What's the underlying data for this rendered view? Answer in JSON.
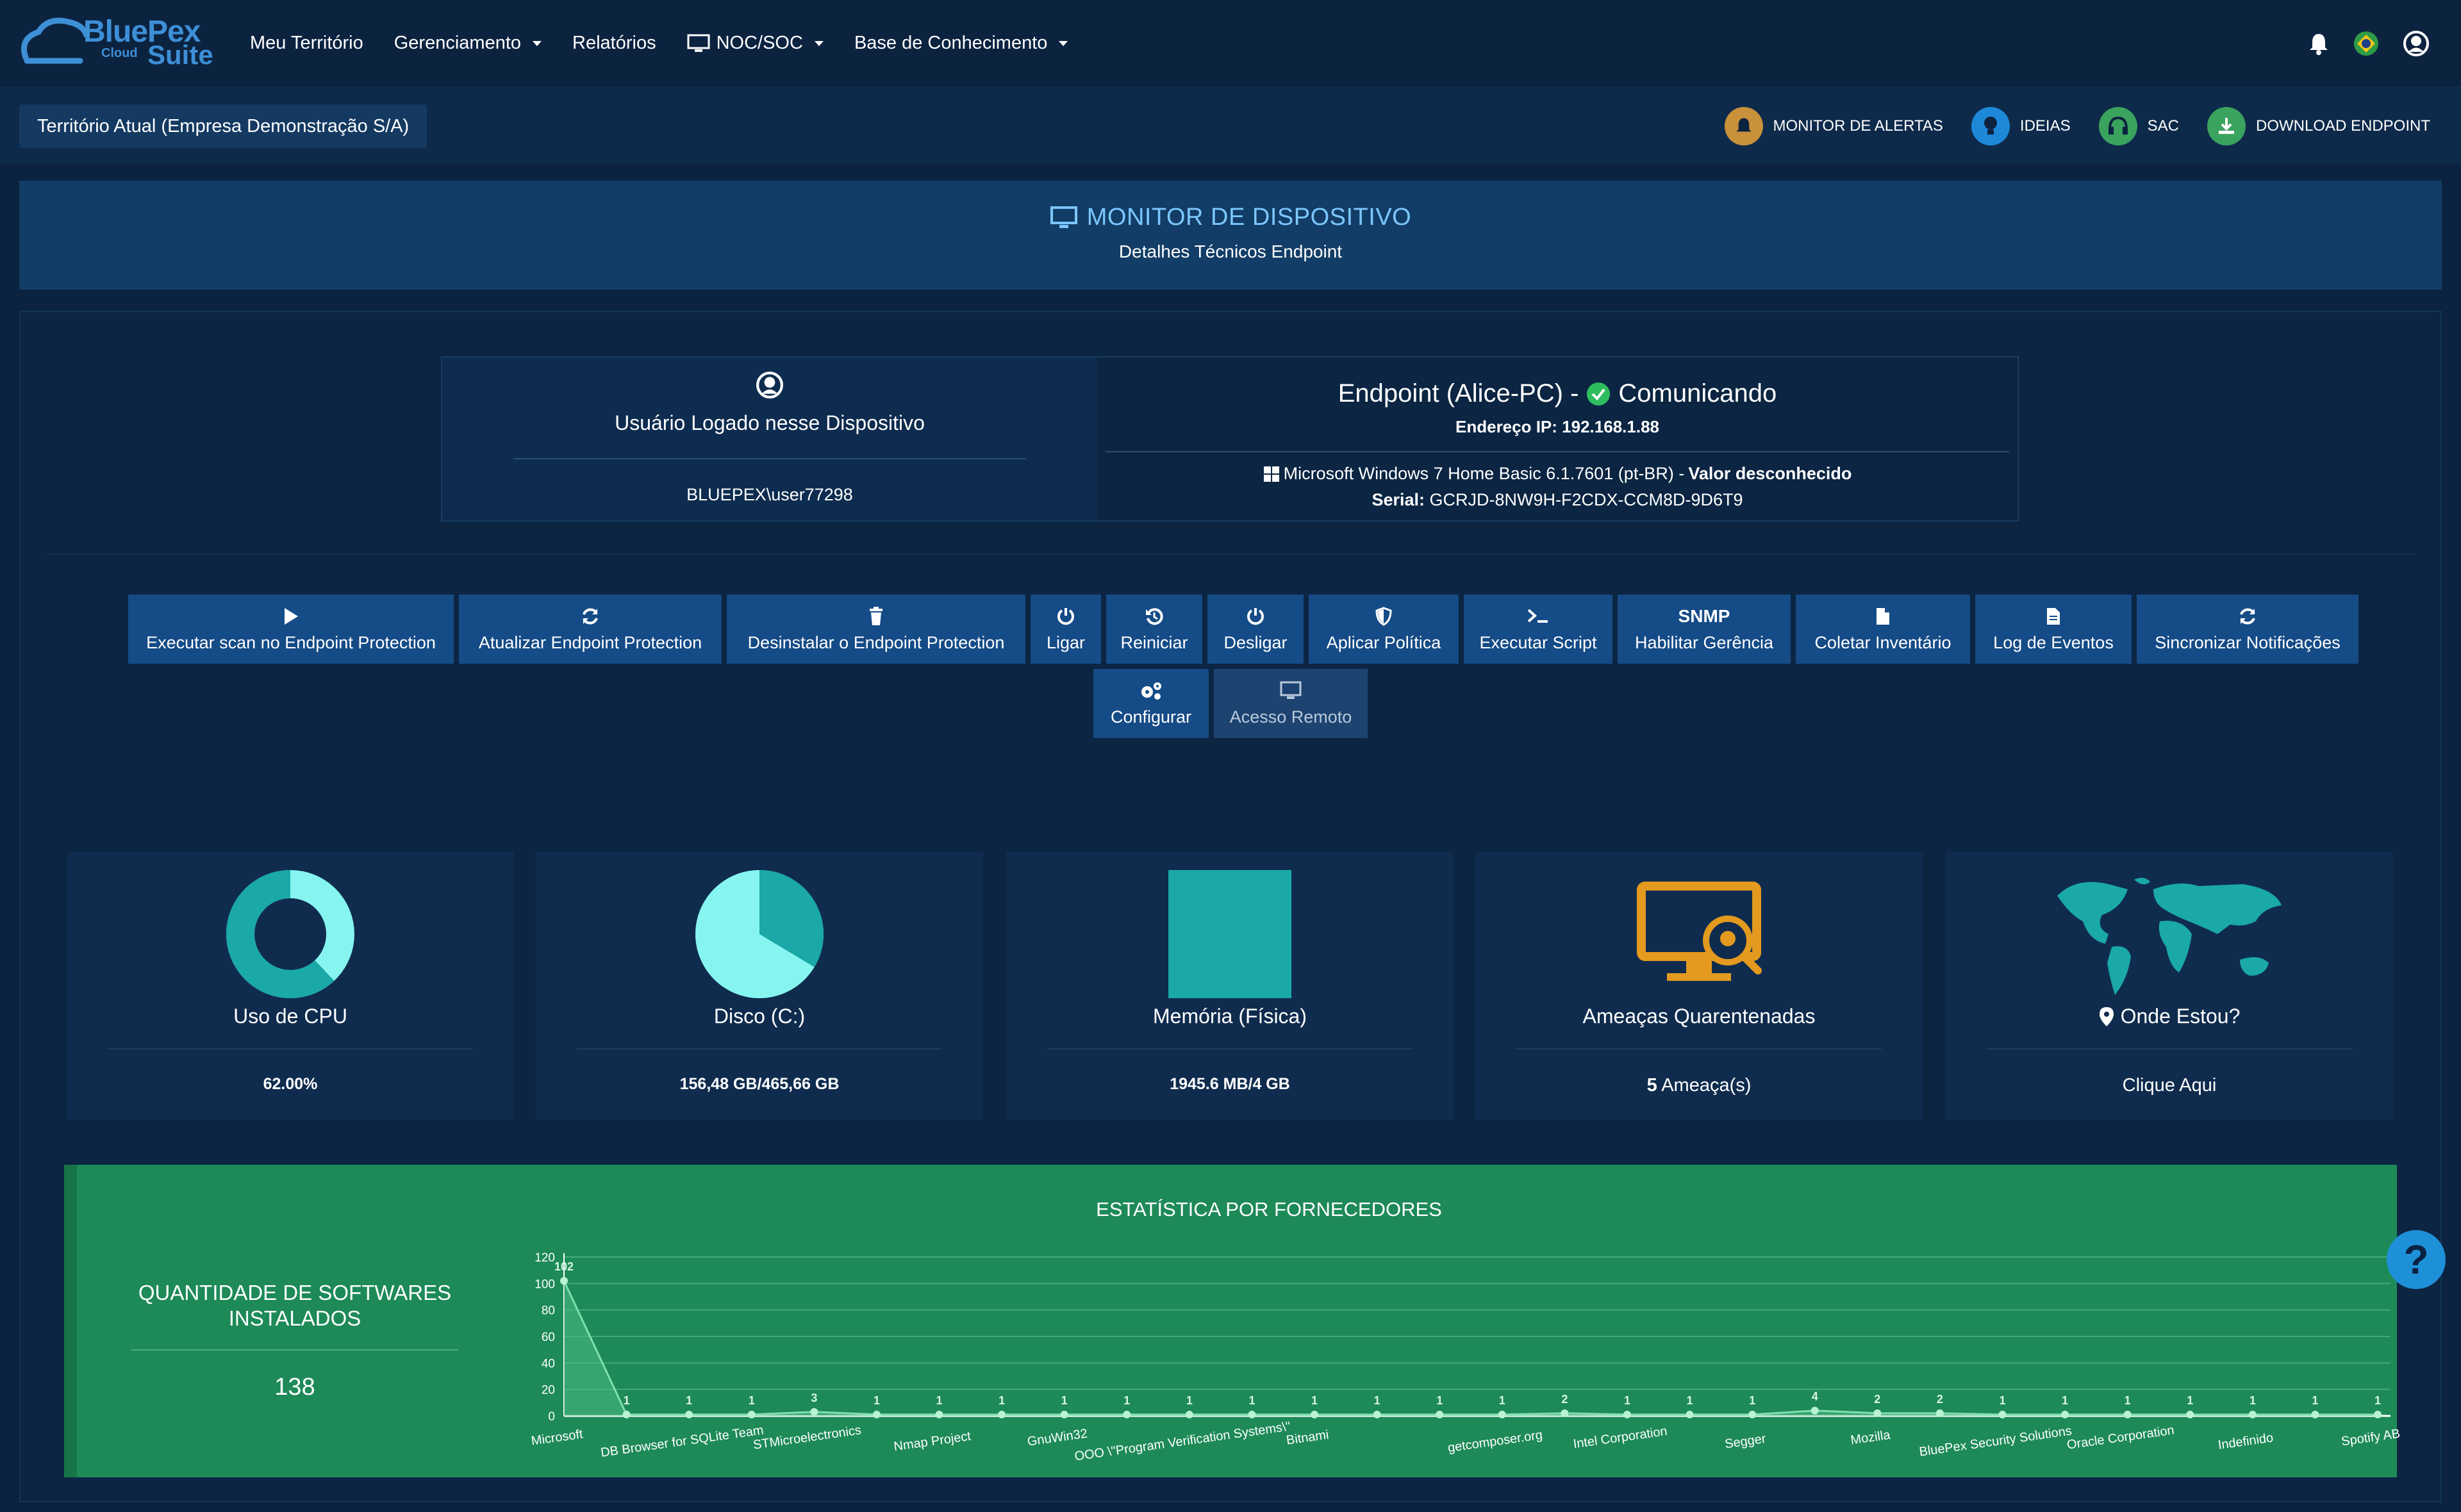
{
  "brand": {
    "name": "BluePex",
    "sub1": "Cloud",
    "sub2": "Suite"
  },
  "nav": {
    "items": [
      {
        "label": "Meu Território",
        "dropdown": false
      },
      {
        "label": "Gerenciamento",
        "dropdown": true
      },
      {
        "label": "Relatórios",
        "dropdown": false
      },
      {
        "label": "NOC/SOC",
        "dropdown": true
      },
      {
        "label": "Base de Conhecimento",
        "dropdown": true
      }
    ]
  },
  "territory": "Território Atual (Empresa Demonstração S/A)",
  "quicklinks": [
    {
      "label": "MONITOR DE ALERTAS",
      "color": "#c8913a",
      "icon": "bell-icon"
    },
    {
      "label": "IDEIAS",
      "color": "#1e88d8",
      "icon": "lightbulb-icon"
    },
    {
      "label": "SAC",
      "color": "#3aa35e",
      "icon": "headset-icon"
    },
    {
      "label": "DOWNLOAD ENDPOINT",
      "color": "#3aa35e",
      "icon": "download-icon"
    }
  ],
  "header": {
    "title": "MONITOR DE DISPOSITIVO",
    "subtitle": "Detalhes Técnicos Endpoint"
  },
  "user": {
    "heading": "Usuário Logado nesse Dispositivo",
    "value": "BLUEPEX\\user77298"
  },
  "endpoint": {
    "title": "Endpoint (Alice-PC) -",
    "status": "Comunicando",
    "ip_label": "Endereço IP:",
    "ip": "192.168.1.88",
    "os": "Microsoft Windows 7 Home Basic 6.1.7601 (pt-BR) -",
    "os_extra": "Valor desconhecido",
    "serial_label": "Serial:",
    "serial": "GCRJD-8NW9H-F2CDX-CCM8D-9D6T9"
  },
  "actions": [
    {
      "label": "Executar scan no Endpoint Protection",
      "icon": "play-icon"
    },
    {
      "label": "Atualizar Endpoint Protection",
      "icon": "refresh-icon"
    },
    {
      "label": "Desinstalar o Endpoint Protection",
      "icon": "trash-icon"
    },
    {
      "label": "Ligar",
      "icon": "power-icon"
    },
    {
      "label": "Reiniciar",
      "icon": "restart-icon"
    },
    {
      "label": "Desligar",
      "icon": "power-icon"
    },
    {
      "label": "Aplicar Política",
      "icon": "shield-icon"
    },
    {
      "label": "Executar Script",
      "icon": "terminal-icon"
    },
    {
      "label": "Habilitar Gerência",
      "icon": "snmp-icon",
      "icon_text": "SNMP"
    },
    {
      "label": "Coletar Inventário",
      "icon": "file-icon"
    },
    {
      "label": "Log de Eventos",
      "icon": "file-text-icon"
    },
    {
      "label": "Sincronizar Notificações",
      "icon": "refresh-icon"
    }
  ],
  "actions2": [
    {
      "label": "Configurar",
      "icon": "cogs-icon",
      "disabled": false
    },
    {
      "label": "Acesso Remoto",
      "icon": "monitor-icon",
      "disabled": true
    }
  ],
  "stats": {
    "cpu": {
      "label": "Uso de CPU",
      "value": "62.00%",
      "fraction": 0.62
    },
    "disk": {
      "label": "Disco (C:)",
      "value": "156,48 GB/465,66 GB",
      "fraction": 0.336
    },
    "memory": {
      "label": "Memória (Física)",
      "value": "1945.6 MB/4 GB"
    },
    "threats": {
      "label": "Ameaças Quarentenadas",
      "count": "5",
      "unit": "Ameaça(s)"
    },
    "location": {
      "label": "Onde Estou?",
      "value": "Clique Aqui"
    }
  },
  "colors": {
    "accent": "#1aa8a8",
    "light": "#86f5f0",
    "green": "#1d8a58"
  },
  "software": {
    "heading": "QUANTIDADE DE SOFTWARES INSTALADOS",
    "value": "138"
  },
  "chart_title": "ESTATÍSTICA POR FORNECEDORES",
  "chart_data": {
    "type": "area",
    "title": "ESTATÍSTICA POR FORNECEDORES",
    "ylim": [
      0,
      120
    ],
    "yticks": [
      0,
      20,
      40,
      60,
      80,
      100,
      120
    ],
    "grid": true,
    "x_labels": [
      "Microsoft",
      "DB Browser for SQLite Team",
      "STMicroelectronics",
      "Nmap Project",
      "GnuWin32",
      "OOO \\\"Program Verification Systems\\\"",
      "Bitnami",
      "getcomposer.org",
      "Intel Corporation",
      "Segger",
      "Mozilla",
      "BluePex Security Solutions",
      "Oracle Corporation",
      "Indefinido",
      "Spotify AB"
    ],
    "values": [
      102,
      1,
      1,
      1,
      3,
      1,
      1,
      1,
      1,
      1,
      1,
      1,
      1,
      1,
      1,
      1,
      2,
      1,
      1,
      1,
      4,
      2,
      2,
      1,
      1,
      1,
      1,
      1,
      1,
      1
    ]
  }
}
